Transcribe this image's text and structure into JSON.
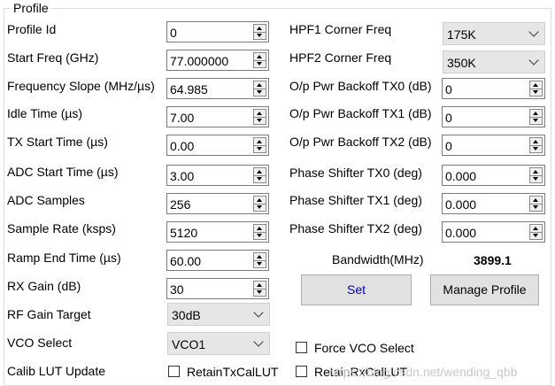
{
  "group_title": "Profile",
  "left_fields": [
    {
      "label": "Profile Id",
      "value": "0"
    },
    {
      "label": "Start Freq (GHz)",
      "value": "77.000000"
    },
    {
      "label": "Frequency Slope (MHz/µs)",
      "value": "64.985"
    },
    {
      "label": "Idle Time (µs)",
      "value": "7.00"
    },
    {
      "label": "TX Start Time (µs)",
      "value": "0.00"
    },
    {
      "label": "ADC Start Time (µs)",
      "value": "3.00"
    },
    {
      "label": "ADC Samples",
      "value": "256"
    },
    {
      "label": "Sample Rate (ksps)",
      "value": "5120"
    },
    {
      "label": "Ramp End Time (µs)",
      "value": "60.00"
    },
    {
      "label": "RX Gain (dB)",
      "value": "30"
    }
  ],
  "rf_gain_target": {
    "label": "RF Gain Target",
    "value": "30dB"
  },
  "vco_select": {
    "label": "VCO Select",
    "value": "VCO1"
  },
  "calib_lut": {
    "label": "Calib LUT Update",
    "tx_label": "RetainTxCalLUT",
    "rx_label": "RetainRxCalLUT",
    "tx_checked": false,
    "rx_checked": false
  },
  "hpf1": {
    "label": "HPF1 Corner Freq",
    "value": "175K"
  },
  "hpf2": {
    "label": "HPF2 Corner Freq",
    "value": "350K"
  },
  "right_fields": [
    {
      "label": "O/p Pwr Backoff TX0 (dB)",
      "value": "0"
    },
    {
      "label": "O/p Pwr Backoff TX1 (dB)",
      "value": "0"
    },
    {
      "label": "O/p Pwr Backoff TX2 (dB)",
      "value": "0"
    },
    {
      "label": "Phase Shifter TX0 (deg)",
      "value": "0.000"
    },
    {
      "label": "Phase Shifter TX1 (deg)",
      "value": "0.000"
    },
    {
      "label": "Phase Shifter TX2 (deg)",
      "value": "0.000"
    }
  ],
  "bandwidth": {
    "label": "Bandwidth(MHz)",
    "value": "3899.1"
  },
  "buttons": {
    "set": "Set",
    "manage": "Manage Profile"
  },
  "force_vco": {
    "label": "Force VCO Select",
    "checked": false
  },
  "watermark": "https://blog.csdn.net/wending_qbb",
  "colors": {
    "set_text": "#0000cc",
    "combo_bg": "#e6e6e6",
    "button_bg": "#e1e1e1"
  }
}
